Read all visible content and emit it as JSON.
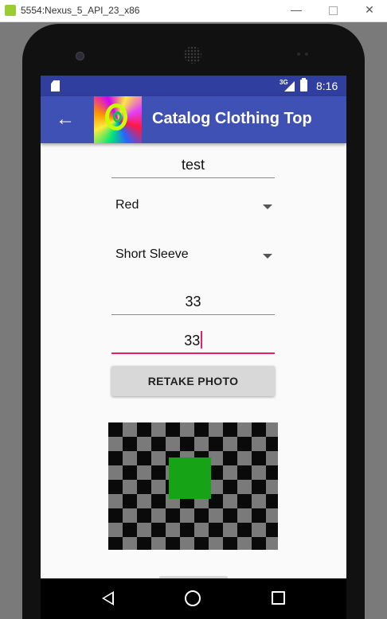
{
  "window": {
    "title": "5554:Nexus_5_API_23_x86",
    "minimize_label": "—",
    "close_label": "✕"
  },
  "statusbar": {
    "network": "3G",
    "time": "8:16"
  },
  "toolbar": {
    "back_icon": "←",
    "title": "Catalog Clothing Top"
  },
  "form": {
    "name_value": "test",
    "color_value": "Red",
    "sleeve_value": "Short Sleeve",
    "size1_value": "33",
    "size2_value": "33",
    "retake_label": "RETAKE PHOTO"
  },
  "colors": {
    "status_bar": "#303f9f",
    "toolbar": "#3f51b5",
    "accent": "#e91e63"
  }
}
